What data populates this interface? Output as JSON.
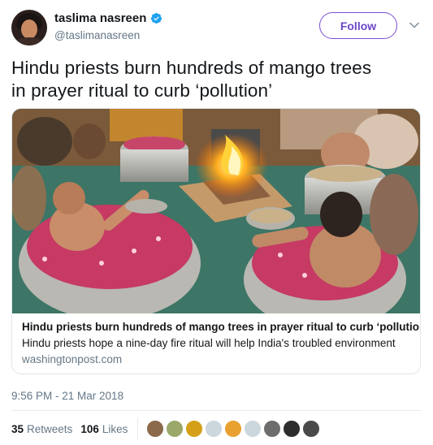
{
  "user": {
    "display_name": "taslima nasreen",
    "handle": "@taslimanasreen",
    "verified": true,
    "follow_label": "Follow"
  },
  "tweet": {
    "text_line1": "Hindu priests burn hundreds of mango trees",
    "text_line2": "in prayer ritual to curb ‘pollution’"
  },
  "card": {
    "image_icon": "photo-priests-fire-ritual",
    "title": "Hindu priests burn hundreds of mango trees in prayer ritual to curb ‘pollution’",
    "description": "Hindu priests hope a nine-day fire ritual will help India's troubled environment",
    "domain": "washingtonpost.com"
  },
  "timestamp": "9:56 PM - 21 Mar 2018",
  "stats": {
    "retweets_count": "35",
    "retweets_label": "Retweets",
    "likes_count": "106",
    "likes_label": "Likes"
  },
  "likers": [
    {
      "name": "liker-avatar",
      "color": "#8a6a4a"
    },
    {
      "name": "liker-avatar",
      "color": "#9aa86a"
    },
    {
      "name": "liker-avatar",
      "color": "#d4a017"
    },
    {
      "name": "liker-avatar",
      "color": "#ccd6dd"
    },
    {
      "name": "liker-avatar",
      "color": "#e8a030"
    },
    {
      "name": "liker-avatar",
      "color": "#ccd6dd"
    },
    {
      "name": "liker-avatar",
      "color": "#6d6d6d"
    },
    {
      "name": "liker-avatar",
      "color": "#2d2d2d"
    },
    {
      "name": "liker-avatar",
      "color": "#4a4a4a"
    }
  ],
  "colors": {
    "follow_accent": "#6b46c9",
    "verified_blue": "#1da1f2",
    "secondary_text": "#657786"
  }
}
